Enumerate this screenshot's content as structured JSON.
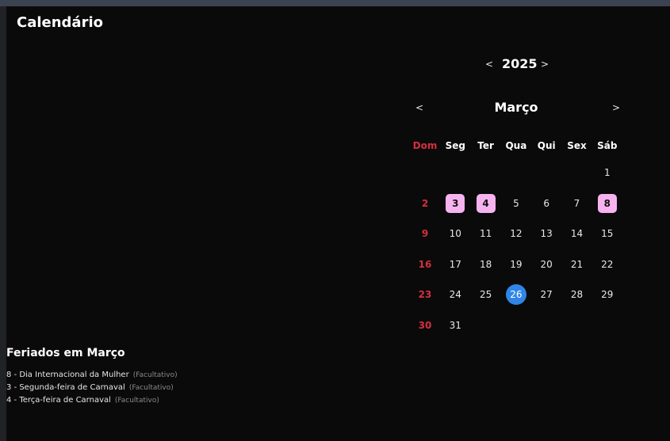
{
  "app": {
    "title": "Calendário"
  },
  "calendar": {
    "year": "2025",
    "month": "Março",
    "prev_symbol": "<",
    "next_symbol": ">",
    "weekdays": [
      "Dom",
      "Seg",
      "Ter",
      "Qua",
      "Qui",
      "Sex",
      "Sáb"
    ],
    "weeks": [
      [
        "",
        "",
        "",
        "",
        "",
        "",
        "1"
      ],
      [
        "2",
        "3",
        "4",
        "5",
        "6",
        "7",
        "8"
      ],
      [
        "9",
        "10",
        "11",
        "12",
        "13",
        "14",
        "15"
      ],
      [
        "16",
        "17",
        "18",
        "19",
        "20",
        "21",
        "22"
      ],
      [
        "23",
        "24",
        "25",
        "26",
        "27",
        "28",
        "29"
      ],
      [
        "30",
        "31",
        "",
        "",
        "",
        "",
        ""
      ]
    ],
    "holiday_days": [
      "3",
      "4",
      "8"
    ],
    "today": "26",
    "colors": {
      "sunday": "#d32f3f",
      "holiday_bg": "#f7b3f0",
      "today_bg": "#2f86e8"
    }
  },
  "holidays": {
    "title": "Feriados em Março",
    "items": [
      {
        "text": "8 - Dia Internacional da Mulher",
        "tag": "(Facultativo)"
      },
      {
        "text": "3 - Segunda-feira de Carnaval",
        "tag": "(Facultativo)"
      },
      {
        "text": "4 - Terça-feira de Carnaval",
        "tag": "(Facultativo)"
      }
    ]
  }
}
